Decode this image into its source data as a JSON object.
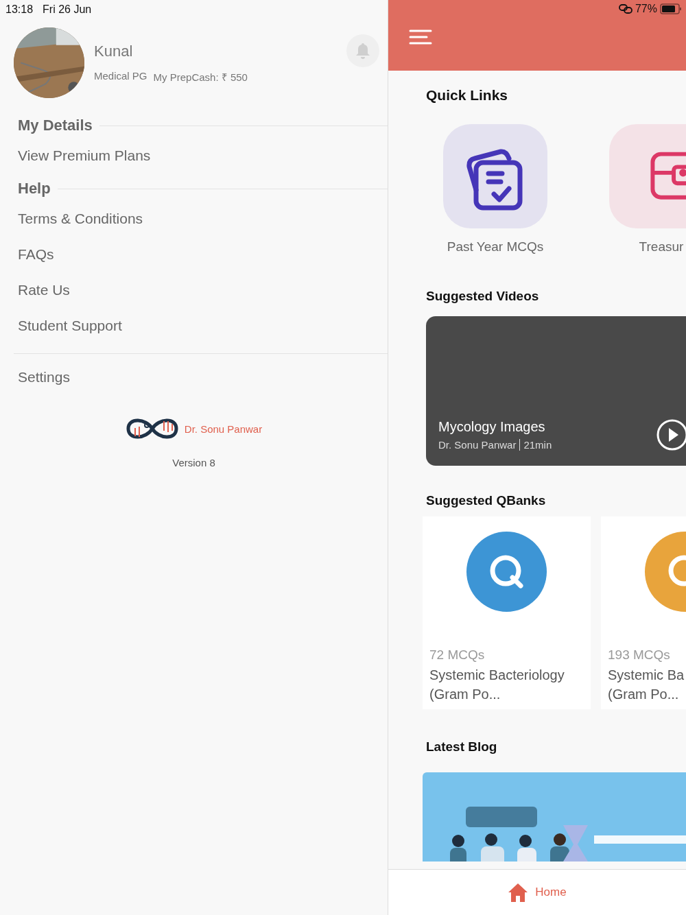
{
  "status_bar": {
    "time": "13:18",
    "date": "Fri 26 Jun",
    "battery": "77%"
  },
  "drawer": {
    "profile": {
      "name": "Kunal",
      "course": "Medical PG",
      "prepcash": "My PrepCash: ₹ 550"
    },
    "sections": [
      {
        "heading": "My Details",
        "items": [
          "View Premium Plans"
        ]
      },
      {
        "heading": "Help",
        "items": [
          "Terms & Conditions",
          "FAQs",
          "Rate Us",
          "Student Support"
        ]
      }
    ],
    "footer_items": [
      "Settings"
    ],
    "brand": "Dr. Sonu Panwar",
    "version": "Version 8"
  },
  "home": {
    "quick_links_title": "Quick Links",
    "quick_links": [
      {
        "label": "Past Year MCQs",
        "kind": "clipboard",
        "color": "#4535b8"
      },
      {
        "label": "Treasur",
        "kind": "chest",
        "color": "#dc3866"
      }
    ],
    "videos_title": "Suggested Videos",
    "video": {
      "title": "Mycology Images",
      "author": "Dr. Sonu Panwar",
      "duration": "21min"
    },
    "qbanks_title": "Suggested QBanks",
    "qbanks": [
      {
        "count": "72 MCQs",
        "title_lines": [
          "Systemic Bacteriology",
          "(Gram Po..."
        ],
        "color": "#3d95d5"
      },
      {
        "count": "193 MCQs",
        "title_lines": [
          "Systemic Ba",
          "(Gram Po..."
        ],
        "color": "#e8a43c"
      }
    ],
    "blog_title": "Latest Blog",
    "tabs": [
      {
        "label": "Home",
        "selected": true
      }
    ]
  }
}
